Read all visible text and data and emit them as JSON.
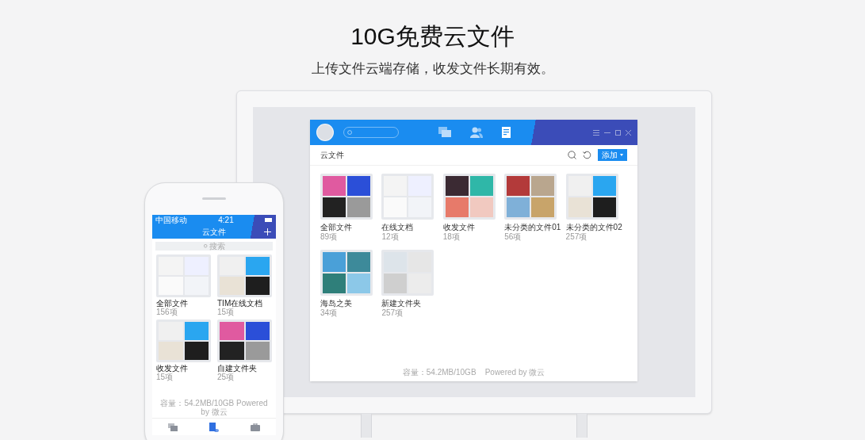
{
  "heading": {
    "title": "10G免费云文件",
    "subtitle": "上传文件云端存储，收发文件长期有效。"
  },
  "desktop": {
    "nav": [
      {
        "kind": "chat",
        "selected": false
      },
      {
        "kind": "contacts",
        "selected": false
      },
      {
        "kind": "docs",
        "selected": true
      }
    ],
    "toolbar_title": "云文件",
    "add_button": "添加",
    "folders": [
      {
        "name": "全部文件",
        "count": "89项"
      },
      {
        "name": "在线文档",
        "count": "12项"
      },
      {
        "name": "收发文件",
        "count": "18项"
      },
      {
        "name": "未分类的文件01",
        "count": "56项"
      },
      {
        "name": "未分类的文件02",
        "count": "257项"
      },
      {
        "name": "海岛之美",
        "count": "34项"
      },
      {
        "name": "新建文件夹",
        "count": "257项"
      }
    ],
    "footer": "容量：54.2MB/10GB    Powered by 微云"
  },
  "phone": {
    "carrier": "中国移动",
    "time": "4:21",
    "title": "云文件",
    "search_placeholder": "搜索",
    "folders": [
      {
        "name": "全部文件",
        "count": "156项"
      },
      {
        "name": "TIM在线文档",
        "count": "15项"
      },
      {
        "name": "收发文件",
        "count": "15项"
      },
      {
        "name": "自建文件夹",
        "count": "25项"
      }
    ],
    "footer": "容量：54.2MB/10GB Powered by 微云",
    "tabs": [
      {
        "kind": "chat",
        "selected": false
      },
      {
        "kind": "docs",
        "selected": true
      },
      {
        "kind": "briefcase",
        "selected": false
      }
    ]
  }
}
